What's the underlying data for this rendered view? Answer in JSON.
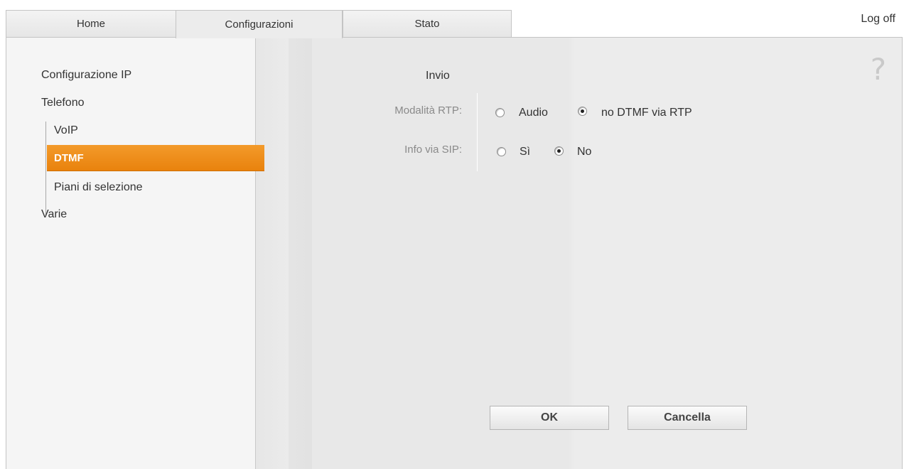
{
  "tabs": {
    "home": "Home",
    "configurazioni": "Configurazioni",
    "stato": "Stato"
  },
  "header": {
    "logoff": "Log off"
  },
  "sidebar": {
    "configurazione_ip": "Configurazione IP",
    "telefono": "Telefono",
    "voip": "VoIP",
    "dtmf": "DTMF",
    "piani": "Piani di selezione",
    "varie": "Varie"
  },
  "help": {
    "symbol": "?"
  },
  "form": {
    "section_title": "Invio",
    "rtp": {
      "label": "Modalità RTP:",
      "option1": "Audio",
      "option2": "no DTMF via RTP",
      "selected": "no DTMF via RTP"
    },
    "sip": {
      "label": "Info via SIP:",
      "option1": "Sì",
      "option2": "No",
      "selected": "No"
    }
  },
  "buttons": {
    "ok": "OK",
    "cancel": "Cancella"
  },
  "colors": {
    "active_nav": "#ef8f1e"
  }
}
